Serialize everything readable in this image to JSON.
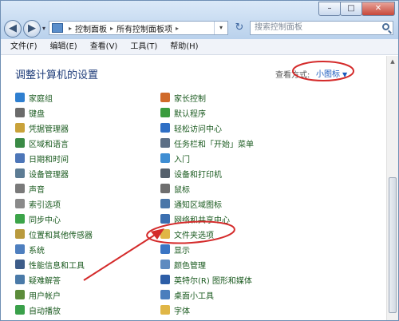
{
  "window": {
    "min_btn": "–",
    "max_btn": "□",
    "close_btn": "✕"
  },
  "nav": {
    "back": "◀",
    "forward": "▶",
    "drop": "▾"
  },
  "address": {
    "crumbs": [
      "控制面板",
      "所有控制面板项"
    ],
    "separator": "▸",
    "drop": "▾",
    "refresh": "↻"
  },
  "search": {
    "placeholder": "搜索控制面板"
  },
  "menu": [
    "文件(F)",
    "编辑(E)",
    "查看(V)",
    "工具(T)",
    "帮助(H)"
  ],
  "main": {
    "heading": "调整计算机的设置",
    "view_by_label": "查看方式:",
    "view_by_value": "小图标",
    "view_by_arrow": "▼"
  },
  "items_left": [
    {
      "label": "家庭组",
      "icon": "homegroup-icon",
      "color": "#2f7fd0"
    },
    {
      "label": "键盘",
      "icon": "keyboard-icon",
      "color": "#6b6b6b"
    },
    {
      "label": "凭据管理器",
      "icon": "credential-manager-icon",
      "color": "#c9a23a"
    },
    {
      "label": "区域和语言",
      "icon": "region-language-icon",
      "color": "#3a8a45"
    },
    {
      "label": "日期和时间",
      "icon": "clock-icon",
      "color": "#4d76b8"
    },
    {
      "label": "设备管理器",
      "icon": "device-manager-icon",
      "color": "#5d7c94"
    },
    {
      "label": "声音",
      "icon": "speaker-icon",
      "color": "#7a7a7a"
    },
    {
      "label": "索引选项",
      "icon": "indexing-icon",
      "color": "#8a8a8a"
    },
    {
      "label": "同步中心",
      "icon": "sync-center-icon",
      "color": "#3ca449"
    },
    {
      "label": "位置和其他传感器",
      "icon": "sensor-icon",
      "color": "#b99a3d"
    },
    {
      "label": "系统",
      "icon": "system-icon",
      "color": "#4e7fbf"
    },
    {
      "label": "性能信息和工具",
      "icon": "performance-icon",
      "color": "#3d5c89"
    },
    {
      "label": "疑难解答",
      "icon": "troubleshooting-icon",
      "color": "#4a7aa8"
    },
    {
      "label": "用户帐户",
      "icon": "user-accounts-icon",
      "color": "#5b8c3a"
    },
    {
      "label": "自动播放",
      "icon": "autoplay-icon",
      "color": "#3aa04a"
    }
  ],
  "items_right": [
    {
      "label": "家长控制",
      "icon": "parental-controls-icon",
      "color": "#d06a2a"
    },
    {
      "label": "默认程序",
      "icon": "default-programs-icon",
      "color": "#3a9c3e"
    },
    {
      "label": "轻松访问中心",
      "icon": "ease-of-access-icon",
      "color": "#2f6fc5"
    },
    {
      "label": "任务栏和「开始」菜单",
      "icon": "taskbar-icon",
      "color": "#5c6f86"
    },
    {
      "label": "入门",
      "icon": "getting-started-icon",
      "color": "#3f8ed3"
    },
    {
      "label": "设备和打印机",
      "icon": "printer-icon",
      "color": "#55606c"
    },
    {
      "label": "鼠标",
      "icon": "mouse-icon",
      "color": "#6e6e6e"
    },
    {
      "label": "通知区域图标",
      "icon": "notification-area-icon",
      "color": "#4a76a8"
    },
    {
      "label": "网络和共享中心",
      "icon": "network-icon",
      "color": "#3b6fb0"
    },
    {
      "label": "文件夹选项",
      "icon": "folder-options-icon",
      "color": "#e0b646"
    },
    {
      "label": "显示",
      "icon": "display-icon",
      "color": "#3a75c4"
    },
    {
      "label": "颜色管理",
      "icon": "color-management-icon",
      "color": "#5f8bc0"
    },
    {
      "label": "英特尔(R) 图形和媒体",
      "icon": "intel-graphics-icon",
      "color": "#2d5ea7"
    },
    {
      "label": "桌面小工具",
      "icon": "gadgets-icon",
      "color": "#4b7ebd"
    },
    {
      "label": "字体",
      "icon": "fonts-icon",
      "color": "#e0b646"
    }
  ],
  "annotation_color": "#d42b2b"
}
